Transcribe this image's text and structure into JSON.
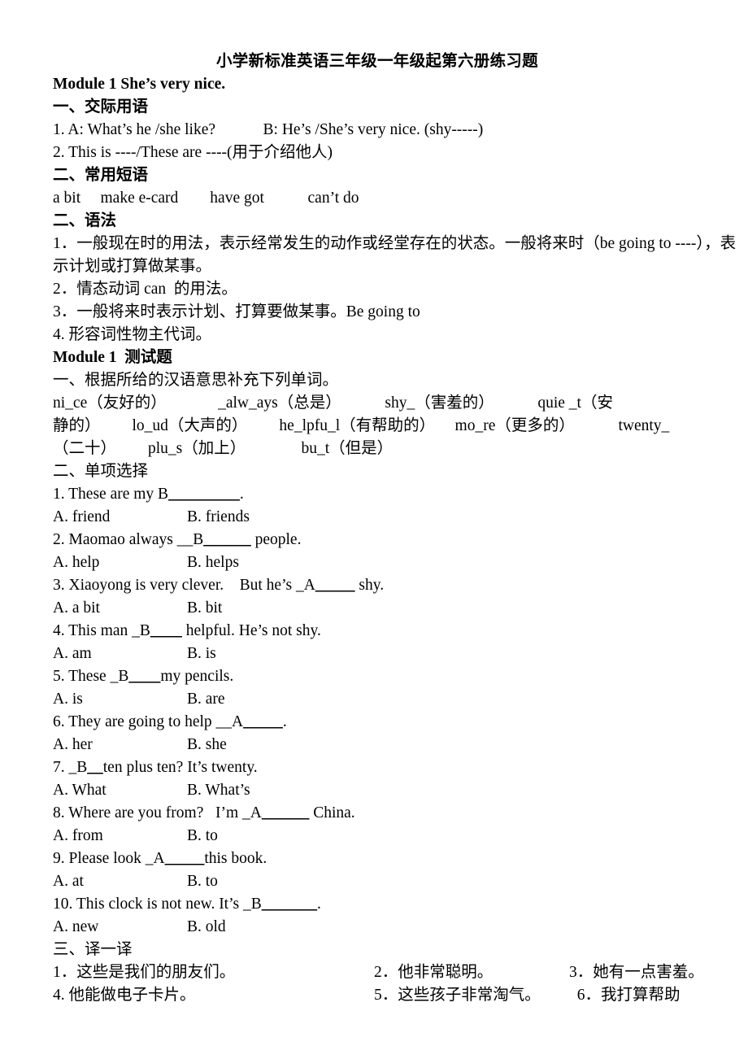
{
  "document": {
    "title": "小学新标准英语三年级一年级起第六册练习题",
    "module_heading": "Module 1 She’s very nice.",
    "sections": [
      {
        "heading": "一、交际用语",
        "lines": [
          "1. A: What’s he /she like?            B: He’s /She’s very nice. (shy-----)",
          "2. This is ----/These are ----(用于介绍他人)"
        ]
      },
      {
        "heading": "二、常用短语",
        "lines": [
          "a bit     make e-card      can’t do"
        ],
        "phrases": "a bit     make e-card        have got           can’t do"
      },
      {
        "heading": "二、语法",
        "lines": [
          "1．一般现在时的用法，表示经常发生的动作或经堂存在的状态。一般将来时（be going to ----），表示计划或打算做某事。",
          "2．情态动词 can  的用法。",
          "3．一般将来时表示计划、打算要做某事。Be going to",
          "4. 形容词性物主代词。"
        ]
      }
    ],
    "test_heading": "Module 1  测试题",
    "part_one": {
      "heading": "一、根据所给的汉语意思补充下列单词。",
      "lines": [
        "ni_ce（友好的）             _alw_ays（总是）           shy_（害羞的）           quie _t（安",
        "静的）        lo_ud（大声的）        he_lpfu_l（有帮助的）     mo_re（更多的）           twenty_",
        "（二十）        plu_s（加上）              bu_t（但是）"
      ],
      "words": [
        {
          "word": "ni_ce",
          "meaning": "（友好的）"
        },
        {
          "word": "_alw_ays",
          "meaning": "（总是）"
        },
        {
          "word": "shy_",
          "meaning": "（害羞的）"
        },
        {
          "word": "quie _t",
          "meaning": "（安静的）"
        },
        {
          "word": "lo_ud",
          "meaning": "（大声的）"
        },
        {
          "word": "he_lpfu_l",
          "meaning": "（有帮助的）"
        },
        {
          "word": "mo_re",
          "meaning": "（更多的）"
        },
        {
          "word": "twenty_",
          "meaning": "（二十）"
        },
        {
          "word": "plu_s",
          "meaning": "（加上）"
        },
        {
          "word": "bu_t",
          "meaning": "（但是）"
        }
      ]
    },
    "part_two": {
      "heading": "二、单项选择",
      "questions": [
        {
          "number": "1.",
          "text_before": "1. These are my B",
          "blank": "_________",
          "text_after": ".",
          "answer": "B",
          "option_a": "A. friend",
          "option_b": "B. friends"
        },
        {
          "number": "2.",
          "text_before": "2. Maomao always __B",
          "blank": "______",
          "text_after": " people.",
          "answer": "B",
          "option_a": "A. help",
          "option_b": "B. helps"
        },
        {
          "number": "3.",
          "text_before": "3. Xiaoyong is very clever.    But he’s _A",
          "blank": "_____",
          "text_after": " shy.",
          "answer": "A",
          "option_a": "A. a bit",
          "option_b": "B. bit"
        },
        {
          "number": "4.",
          "text_before": "4. This man _B",
          "blank": "____",
          "text_after": " helpful. He’s not shy.",
          "answer": "B",
          "option_a": "A. am",
          "option_b": "B. is"
        },
        {
          "number": "5.",
          "text_before": "5. These _B",
          "blank": "____",
          "text_after": "my pencils.",
          "answer": "B",
          "option_a": "A. is",
          "option_b": "B. are"
        },
        {
          "number": "6.",
          "text_before": "6. They are going to help __A",
          "blank": "_____",
          "text_after": ".",
          "answer": "A",
          "option_a": "A. her",
          "option_b": "B. she"
        },
        {
          "number": "7.",
          "text_before": "7. _B",
          "blank": "__",
          "text_after": "ten plus ten? It’s twenty.",
          "answer": "B",
          "option_a": "A. What",
          "option_b": "B. What’s"
        },
        {
          "number": "8.",
          "text_before": "8. Where are you from?   I’m _A",
          "blank": "______",
          "text_after": " China.",
          "answer": "A",
          "option_a": "A. from",
          "option_b": "B. to"
        },
        {
          "number": "9.",
          "text_before": "9. Please look _A",
          "blank": "_____",
          "text_after": "this book.",
          "answer": "A",
          "option_a": "A. at",
          "option_b": "B. to"
        },
        {
          "number": "10.",
          "text_before": "10. This clock is not new. It’s _B",
          "blank": "_______",
          "text_after": ".",
          "answer": "B",
          "option_a": "A. new",
          "option_b": "B. old"
        }
      ]
    },
    "part_three": {
      "heading": "三、译一译",
      "rows": [
        {
          "c1": "1．这些是我们的朋友们。",
          "c2": "2．他非常聪明。",
          "c3": "3．她有一点害羞。"
        },
        {
          "c1": "4. 他能做电子卡片。",
          "c2": "5．这些孩子非常淘气。",
          "c3": "  6．我打算帮助"
        }
      ]
    }
  }
}
